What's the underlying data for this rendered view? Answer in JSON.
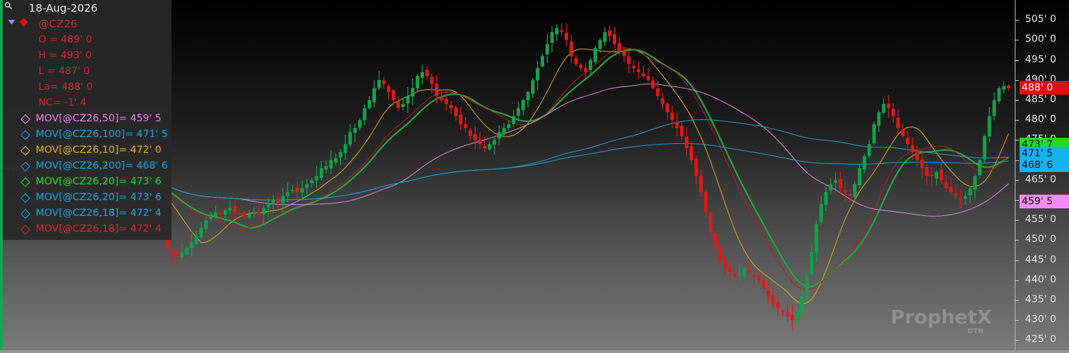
{
  "legend": {
    "date": "18-Aug-2026",
    "symbol": "@CZ26",
    "open": "O = 489' 0",
    "high": "H = 493' 0",
    "low": "L = 487' 0",
    "last": "La= 488' 0",
    "net_change": "NC= -1' 4",
    "studies": [
      {
        "label": "MOV[@CZ26,50]= 459' 5",
        "color": "#f07cf0"
      },
      {
        "label": "MOV[@CZ26,100]= 471' 5",
        "color": "#14a6e6"
      },
      {
        "label": "MOV[@CZ26,10]= 472' 0",
        "color": "#e5b118"
      },
      {
        "label": "MOV[@CZ26,200]= 468' 6",
        "color": "#14a6e6"
      },
      {
        "label": "MOV[@CZ26,20]= 473' 6",
        "color": "#20e020"
      },
      {
        "label": "MOV[@CZ26,20]= 473' 6",
        "color": "#14a6e6"
      },
      {
        "label": "MOV[@CZ26,18]= 472' 4",
        "color": "#14a6e6"
      },
      {
        "label": "MOV[@CZ26,18]= 472' 4",
        "color": "#d7262b"
      }
    ]
  },
  "brand": {
    "name": "ProphetX",
    "sub": "DTN"
  },
  "price_tags": [
    {
      "label": "488' 0",
      "value": 488.0,
      "bg": "#e01010",
      "fg": "#ffffff"
    },
    {
      "label": "473' 7",
      "value": 473.875,
      "bg": "#22dd22",
      "fg": "#101010"
    },
    {
      "label": "471' 5",
      "value": 471.625,
      "bg": "#17b3f0",
      "fg": "#101010"
    },
    {
      "label": "468' 6",
      "value": 468.75,
      "bg": "#17b3f0",
      "fg": "#101010"
    },
    {
      "label": "459' 5",
      "value": 459.625,
      "bg": "#f48cf4",
      "fg": "#101010"
    }
  ],
  "chart_data": {
    "type": "candlestick",
    "symbol": "@CZ26",
    "ylim": [
      422.5,
      510
    ],
    "y_ticks": [
      {
        "value": 505,
        "label": "505' 0"
      },
      {
        "value": 500,
        "label": "500' 0"
      },
      {
        "value": 495,
        "label": "495' 0"
      },
      {
        "value": 490,
        "label": "490' 0"
      },
      {
        "value": 485,
        "label": "485' 0"
      },
      {
        "value": 480,
        "label": "480' 0"
      },
      {
        "value": 475,
        "label": "475' 0"
      },
      {
        "value": 470,
        "label": "470' 0"
      },
      {
        "value": 465,
        "label": "465' 0"
      },
      {
        "value": 460,
        "label": "460' 0"
      },
      {
        "value": 455,
        "label": "455' 0"
      },
      {
        "value": 450,
        "label": "450' 0"
      },
      {
        "value": 445,
        "label": "445' 0"
      },
      {
        "value": 440,
        "label": "440' 0"
      },
      {
        "value": 435,
        "label": "435' 0"
      },
      {
        "value": 430,
        "label": "430' 0"
      },
      {
        "value": 425,
        "label": "425' 0"
      }
    ],
    "close_path": [
      468,
      467.5,
      468,
      467,
      466,
      466.5,
      465.5,
      464,
      463.5,
      463,
      462,
      461.5,
      462,
      463,
      464,
      463.5,
      465,
      466,
      465.5,
      466,
      465,
      464.5,
      464,
      463,
      462,
      462.5,
      463.5,
      464.5,
      465.5,
      466,
      465.5,
      466,
      454,
      451,
      448,
      446.5,
      446,
      447,
      448,
      449.5,
      451,
      453,
      455,
      456.5,
      457,
      456.5,
      457.5,
      458,
      457,
      456.5,
      456,
      456.5,
      457,
      456.5,
      458,
      459,
      460,
      459,
      461,
      462,
      462.5,
      462,
      463,
      464,
      465,
      466,
      468,
      468.5,
      470,
      470.5,
      472,
      474,
      477,
      478,
      480,
      483,
      485,
      488,
      490,
      489,
      487,
      485,
      483,
      484,
      486,
      488,
      491,
      492,
      491,
      489,
      486,
      485,
      484,
      483,
      481,
      479,
      478,
      476,
      475,
      474,
      473,
      474,
      475,
      477,
      478,
      479,
      481,
      483,
      485,
      487,
      490,
      493,
      496,
      499,
      502,
      503,
      502,
      500,
      496,
      494,
      493,
      492,
      495,
      498,
      500,
      502,
      501,
      499,
      497,
      496,
      494,
      493,
      492,
      491,
      490,
      488,
      486,
      484,
      482,
      480,
      478,
      476,
      473,
      470,
      466,
      462,
      457,
      452,
      448,
      445,
      443,
      442,
      441,
      441.5,
      443,
      442,
      441,
      440,
      438,
      436,
      434,
      433,
      432,
      431,
      430,
      432,
      436,
      441,
      447,
      454,
      459,
      462,
      464,
      465,
      463,
      462,
      461,
      464,
      468,
      471,
      474,
      479,
      482,
      484,
      483,
      481,
      478,
      476,
      474,
      472,
      470,
      468,
      466,
      466,
      467,
      465,
      463,
      462,
      461,
      460,
      461,
      463,
      466,
      470,
      476,
      481,
      485,
      488,
      488.5,
      488
    ],
    "ma_series": [
      {
        "period": 10,
        "color": "#e5b118",
        "width": 1.0
      },
      {
        "period": 20,
        "color": "#23a840",
        "width": 2.2
      },
      {
        "period": 18,
        "color": "#c21a1a",
        "width": 1.0
      },
      {
        "period": 50,
        "color": "#e48ae4",
        "width": 1.0
      },
      {
        "period": 100,
        "color": "#1ba3d8",
        "width": 1.0
      },
      {
        "period": 200,
        "color": "#1ba3d8",
        "width": 1.0
      }
    ],
    "up_color": "#12a34a",
    "down_color": "#e01818"
  }
}
